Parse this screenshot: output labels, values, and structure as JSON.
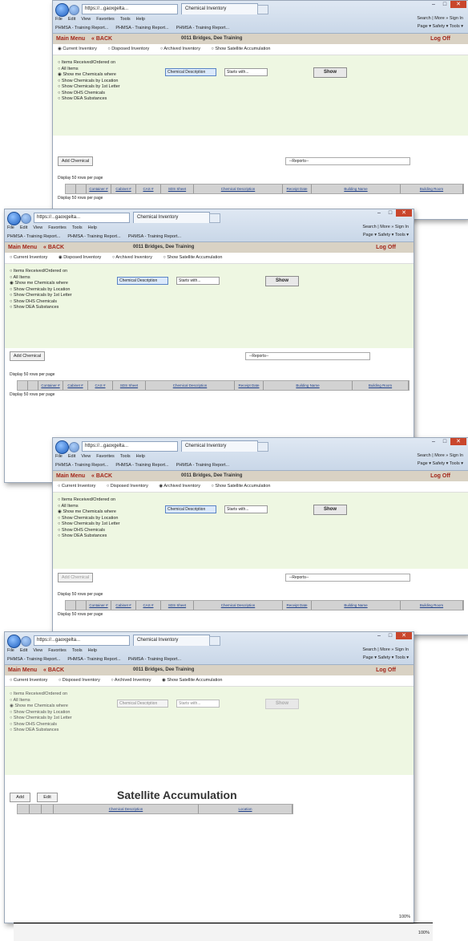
{
  "browser": {
    "address": "https://...gaoxgelta...",
    "tab_title": "Chemical Inventory",
    "menu": [
      "File",
      "Edit",
      "View",
      "Favorites",
      "Tools",
      "Help"
    ],
    "favorites": [
      "PHMSA - Training Report...",
      "PHMSA - Training Report...",
      "PHMSA - Training Report..."
    ],
    "right_cmds": "Search | More »   Sign In",
    "page_tools": "Page ▾  Safety ▾  Tools ▾",
    "zoom": "100%"
  },
  "app": {
    "main_menu": "Main Menu",
    "back": "« BACK",
    "user": "0011  Bridges, Dee Training",
    "logoff": "Log Off"
  },
  "inventory_options": [
    "Current Inventory",
    "Disposed Inventory",
    "Archived Inventory",
    "Show Satellite Accumulation"
  ],
  "filter_options": [
    "Items Received/Ordered on",
    "All Items",
    "Show me Chemicals where",
    "Show Chemicals by Location",
    "Show Chemicals by 1st Letter",
    "Show DHS Chemicals",
    "Show DEA Substances"
  ],
  "filters": {
    "field_select": "Chemical Description",
    "operator_select": "Starts with...",
    "show_button": "Show"
  },
  "actions": {
    "add_chemical": "Add Chemical",
    "reports": "--Reports--",
    "display": "Display",
    "per_page_value": "50",
    "per_page_suffix": "rows per page",
    "add": "Add",
    "edit": "Edit"
  },
  "table_columns": [
    "Container #",
    "Cabinet #",
    "CAS #",
    "SDS Sheet",
    "Chemical Description",
    "Receipt Date",
    "Building Name",
    "Building Room"
  ],
  "satellite": {
    "title": "Satellite Accumulation",
    "columns": [
      "Chemical Description",
      "Location"
    ]
  }
}
